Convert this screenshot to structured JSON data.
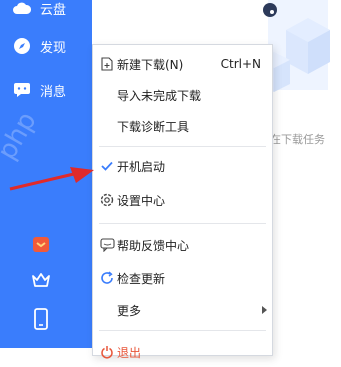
{
  "sidebar": {
    "items": [
      {
        "label": "云盘"
      },
      {
        "label": "发现"
      },
      {
        "label": "消息"
      }
    ]
  },
  "main": {
    "empty_hint": "在下载任务"
  },
  "menu": {
    "items": [
      {
        "label": "新建下载(N)",
        "shortcut": "Ctrl+N"
      },
      {
        "label": "导入未完成下载"
      },
      {
        "label": "下载诊断工具"
      },
      {
        "label": "开机启动",
        "checked": true
      },
      {
        "label": "设置中心"
      },
      {
        "label": "帮助反馈中心"
      },
      {
        "label": "检查更新"
      },
      {
        "label": "更多"
      }
    ],
    "partial_label": "退出"
  },
  "watermark": "php"
}
